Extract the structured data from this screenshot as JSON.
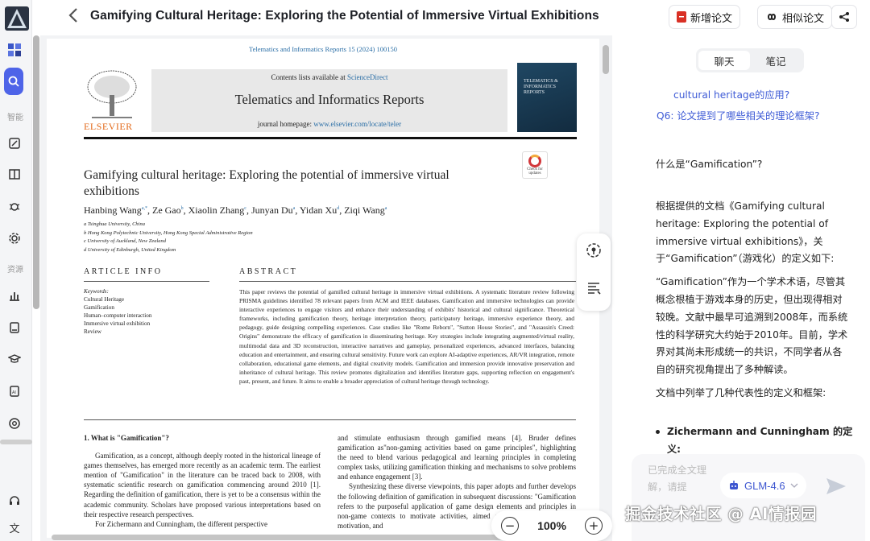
{
  "header": {
    "title": "Gamifying Cultural Heritage: Exploring the Potential of Immersive Virtual Exhibitions",
    "add_paper": "新增论文",
    "similar_paper": "相似论文"
  },
  "sidebar": {
    "section_smart": "智能",
    "section_resources": "资源",
    "bottom_lang": "文"
  },
  "paper": {
    "journal_ref": "Telematics and Informatics Reports 15 (2024) 100150",
    "contents_prefix": "Contents lists available at",
    "contents_link": "ScienceDirect",
    "journal_name": "Telematics and Informatics Reports",
    "homepage_prefix": "journal homepage:",
    "homepage_link": "www.elsevier.com/locate/teler",
    "publisher": "ELSEVIER",
    "cover_title": "TELEMATICS & INFORMATICS REPORTS",
    "check_updates": "Check for updates",
    "title": "Gamifying cultural heritage: Exploring the potential of immersive virtual exhibitions",
    "authors": [
      {
        "name": "Hanbing Wang",
        "sup": "a,*"
      },
      {
        "name": "Ze Gao",
        "sup": "b"
      },
      {
        "name": "Xiaolin Zhang",
        "sup": "c"
      },
      {
        "name": "Junyan Du",
        "sup": "a"
      },
      {
        "name": "Yidan Xu",
        "sup": "d"
      },
      {
        "name": "Ziqi Wang",
        "sup": "a"
      }
    ],
    "affiliations": [
      "a Tsinghua University, China",
      "b Hong Kong Polytechnic University, Hong Kong Special Administrative Region",
      "c University of Auckland, New Zealand",
      "d University of Edinburgh, United Kingdom"
    ],
    "article_info_head": "ARTICLE INFO",
    "abstract_head": "ABSTRACT",
    "keywords_label": "Keywords:",
    "keywords": [
      "Cultural Heritage",
      "Gamification",
      "Human–computer interaction",
      "Immersive virtual exhibition",
      "Review"
    ],
    "abstract": "This paper reviews the potential of gamified cultural heritage in immersive virtual exhibitions. A systematic literature review following PRISMA guidelines identified 78 relevant papers from ACM and IEEE databases. Gamification and immersive technologies can provide interactive experiences to engage visitors and enhance their understanding of exhibits' historical and cultural significance. Theoretical frameworks, including gamification theory, heritage interpretation theory, participatory heritage, immersive experience theory, and pedagogy, guide designing compelling experiences. Case studies like \"Rome Reborn\", \"Sutton House Stories\", and \"Assassin's Creed: Origins\" demonstrate the efficacy of gamification in disseminating heritage. Key strategies include integrating augmented/virtual reality, multimodal data and 3D reconstruction, interactive narratives and gameplay, personalized experiences, advanced interfaces, balancing education and entertainment, and ensuring cultural sensitivity. Future work can explore AI-adaptive experiences, AR/VR integration, remote collaboration, educational game elements, and digital creativity models. Gamification and immersion provide innovative preservation and inheritance of cultural heritage. This review promotes digitalization and identifies literature gaps, supporting reflection on engagement's past, present, and future. It aims to enable a broader appreciation of cultural heritage through technology.",
    "section1_head": "1.  What is \"Gamification\"?",
    "col1_text": "Gamification, as a concept, although deeply rooted in the historical lineage of games themselves, has emerged more recently as an academic term. The earliest mention of \"Gamification\" in the literature can be traced back to 2008, with systematic scientific research on gamification commencing around 2010 [1]. Regarding the definition of gamification, there is yet to be a consensus within the academic community. Scholars have proposed various interpretations based on their respective research perspectives.",
    "col1_tail": "For Zichermann and Cunningham, the different perspective",
    "col2_text": "and stimulate enthusiasm through gamified means [4]. Bruder defines gamification as\"non-gaming activities based on game principles\", highlighting the need to blend various pedagogical and learning principles in completing complex tasks, utilizing gamification thinking and mechanisms to solve problems and enhance engagement [3].",
    "col2_text_b": "Synthesizing these diverse viewpoints, this paper adopts and further develops the following definition of gamification in subsequent discussions: \"Gamification refers to the purposeful application of game design elements and principles in non-game contexts to motivate activities, aimed at enhancing engagement, motivation, and"
  },
  "zoom": {
    "value": "100%",
    "minus": "−",
    "plus": "+"
  },
  "chat": {
    "tab_chat": "聊天",
    "tab_notes": "笔记",
    "q_prev_tail": "cultural heritage的应用?",
    "q6": "Q6: 论文提到了哪些相关的理论框架?",
    "user_question": "什么是“Gamification”?",
    "answer_p1": "根据提供的文档《Gamifying cultural heritage: Exploring the potential of immersive virtual exhibitions》，关于“Gamification”（游戏化）的定义如下:",
    "answer_p2": "“Gamification”作为一个学术术语，尽管其概念根植于游戏本身的历史，但出现得相对较晚。文献中最早可追溯到2008年，而系统性的科学研究大约始于2010年。目前，学术界对其尚未形成统一的共识，不同学者从各自的研究视角提出了多种解读。",
    "answer_p3": "文档中列举了几种代表性的定义和框架:",
    "bullet1": "Zichermann and Cunningham 的定义:",
    "input_placeholder": "已完成全文理解，请提",
    "model": "GLM-4.6"
  },
  "watermark": "掘金技术社区 @ AI情报园",
  "colors": {
    "accent": "#4e64e8",
    "link": "#3e5bd6",
    "red": "#d93025"
  }
}
